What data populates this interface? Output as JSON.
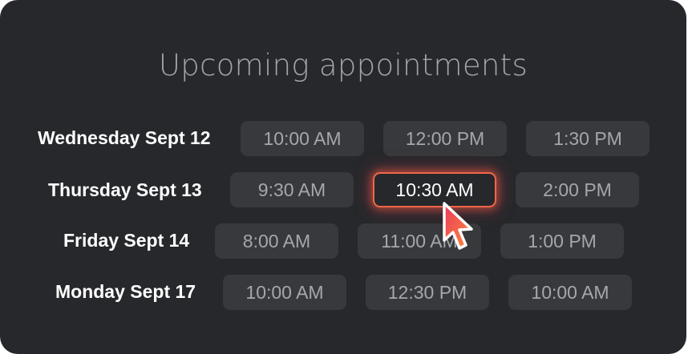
{
  "title": "Upcoming appointments",
  "rows": [
    {
      "day": "Wednesday Sept 12",
      "slots": [
        "10:00 AM",
        "12:00 PM",
        "1:30 PM"
      ]
    },
    {
      "day": "Thursday Sept 13",
      "slots": [
        "9:30 AM",
        "10:30 AM",
        "2:00 PM"
      ]
    },
    {
      "day": "Friday Sept 14",
      "slots": [
        "8:00 AM",
        "11:00 AM",
        "1:00 PM"
      ]
    },
    {
      "day": "Monday Sept 17",
      "slots": [
        "10:00 AM",
        "12:30 PM",
        "10:00 AM"
      ]
    }
  ],
  "selected_slot": "10:30 AM",
  "colors": {
    "background": "#26282b",
    "slot": "#37393d",
    "slot_text": "#a4a7ab",
    "selected_border": "#f0674a",
    "cursor_gradient": [
      "#e8385a",
      "#ff8a3d"
    ]
  },
  "icons": {
    "pointer": "mouse-pointer-icon"
  }
}
